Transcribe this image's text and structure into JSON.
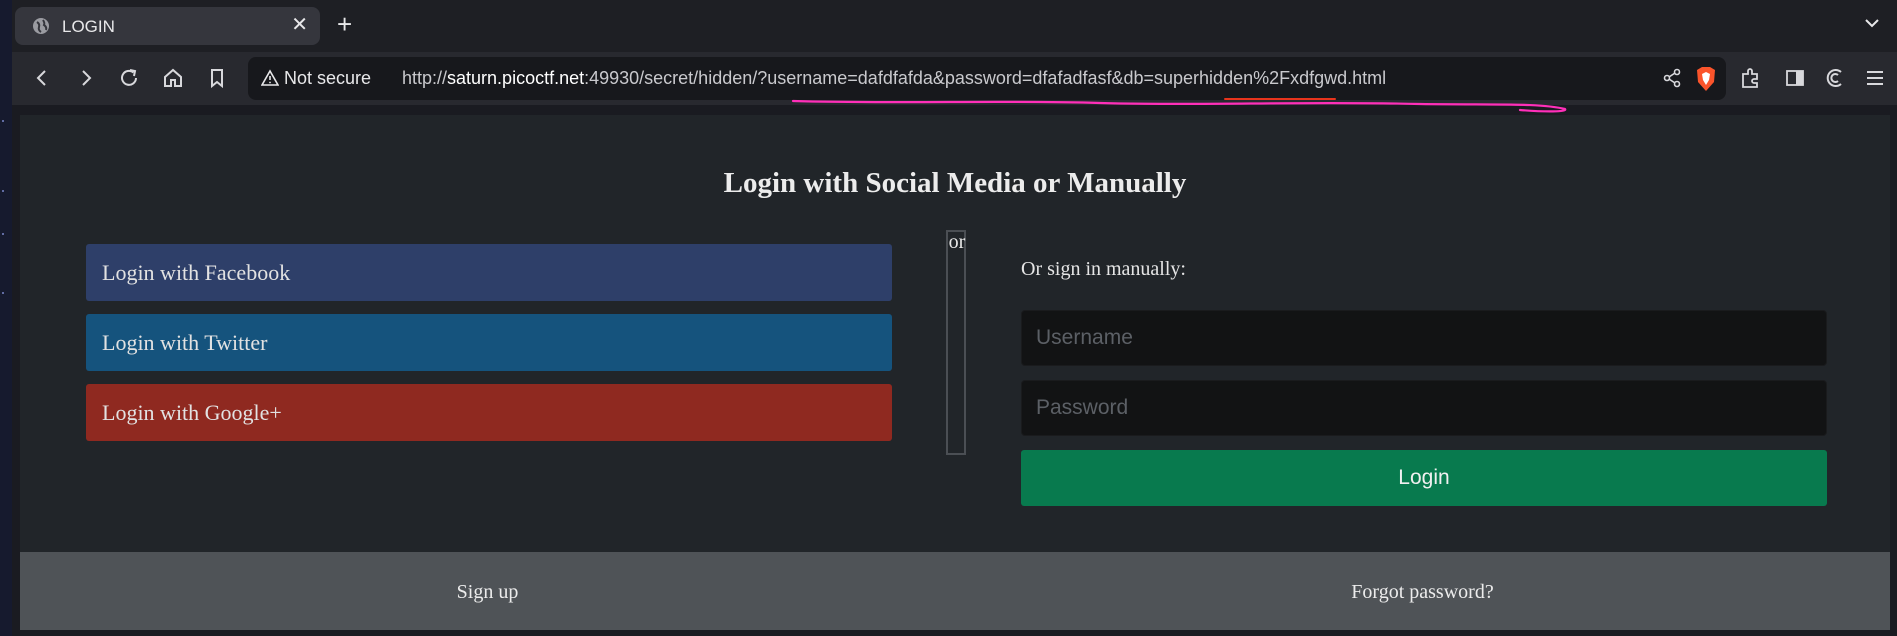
{
  "browser": {
    "tab_title": "LOGIN",
    "tab_close": "✕",
    "new_tab": "+",
    "security_label": "Not secure",
    "url_prefix": "http://",
    "url_host": "saturn.picoctf.net",
    "url_rest": ":49930/secret/hidden/?username=dafdfafda&password=dfafadfasf&db=superhidden%2Fxdfgwd.html",
    "annotation_color": "#ff2fb9",
    "annotation_accent_color": "#e8341c"
  },
  "page": {
    "title": "Login with Social Media or Manually",
    "social": {
      "facebook": "Login with Facebook",
      "twitter": "Login with Twitter",
      "google": "Login with Google+"
    },
    "divider_text": "or",
    "manual_label": "Or sign in manually:",
    "username_placeholder": "Username",
    "password_placeholder": "Password",
    "login_button": "Login",
    "footer": {
      "signup": "Sign up",
      "forgot": "Forgot password?"
    },
    "colors": {
      "facebook": "#2e3f69",
      "twitter": "#15537d",
      "google": "#8f2920",
      "login": "#087a4e"
    }
  }
}
